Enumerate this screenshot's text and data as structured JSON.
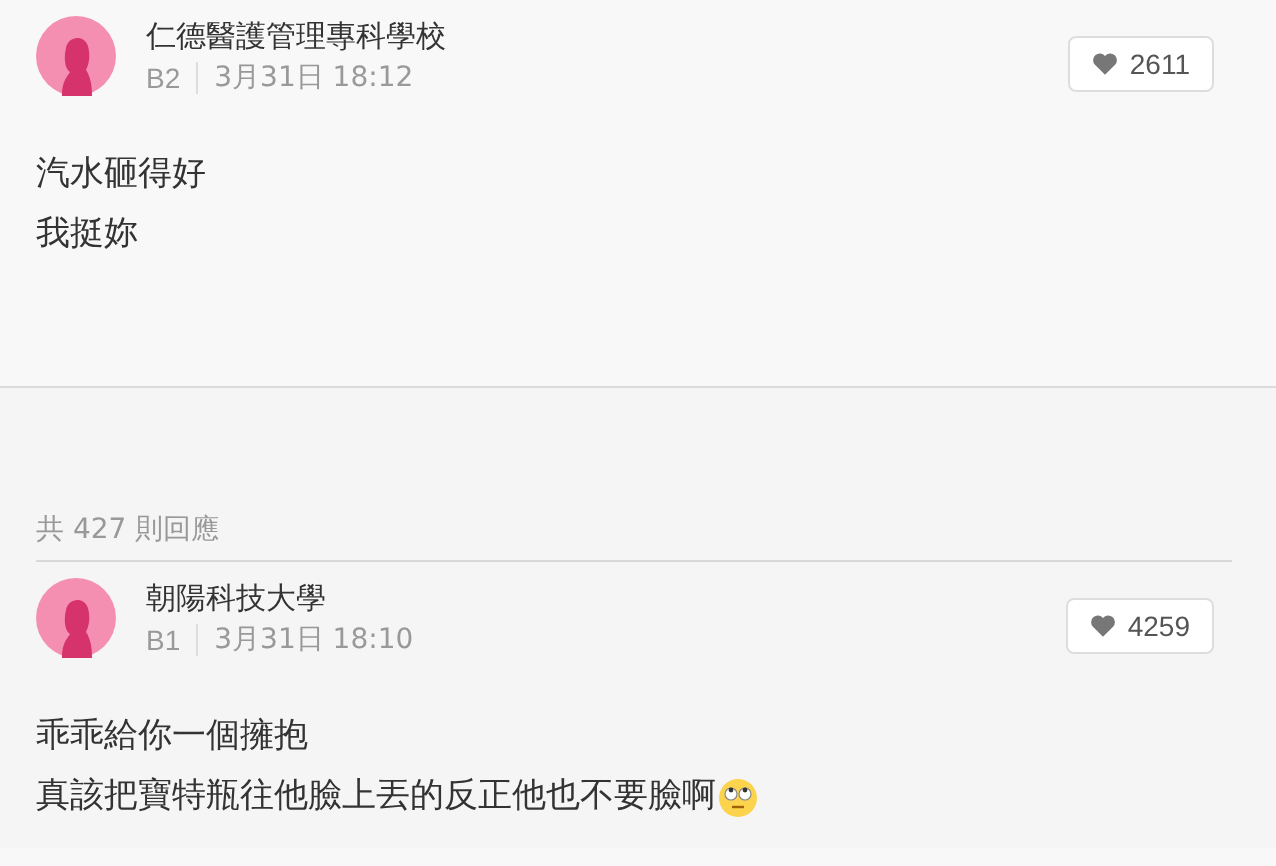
{
  "posts": [
    {
      "author": "仁德醫護管理專科學校",
      "floor": "B2",
      "time": "3月31日 18:12",
      "likes": "2611",
      "lines": [
        "汽水砸得好",
        "我挺妳"
      ],
      "emoji": false
    },
    {
      "author": "朝陽科技大學",
      "floor": "B1",
      "time": "3月31日 18:10",
      "likes": "4259",
      "lines": [
        "乖乖給你一個擁抱",
        "真該把寶特瓶往他臉上丟的反正他也不要臉啊"
      ],
      "emoji": true
    }
  ],
  "replies_count": "共 427 則回應"
}
